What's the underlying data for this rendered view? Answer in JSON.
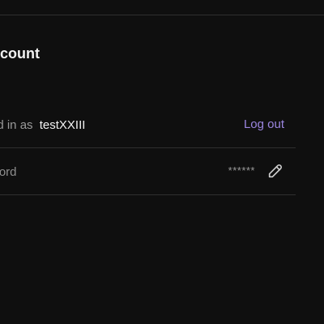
{
  "account": {
    "title": "ccount",
    "login": {
      "prefix": "ed in as",
      "username": "testXXIII",
      "logout_label": "Log out"
    },
    "password": {
      "label": "word",
      "mask": "******",
      "edit_icon": "pencil-icon"
    }
  },
  "colors": {
    "background": "#0f0f0f",
    "text_primary": "#f2f2f2",
    "text_secondary": "#9a9a9a",
    "accent": "#9b86e0",
    "divider": "#2f2f2f"
  }
}
